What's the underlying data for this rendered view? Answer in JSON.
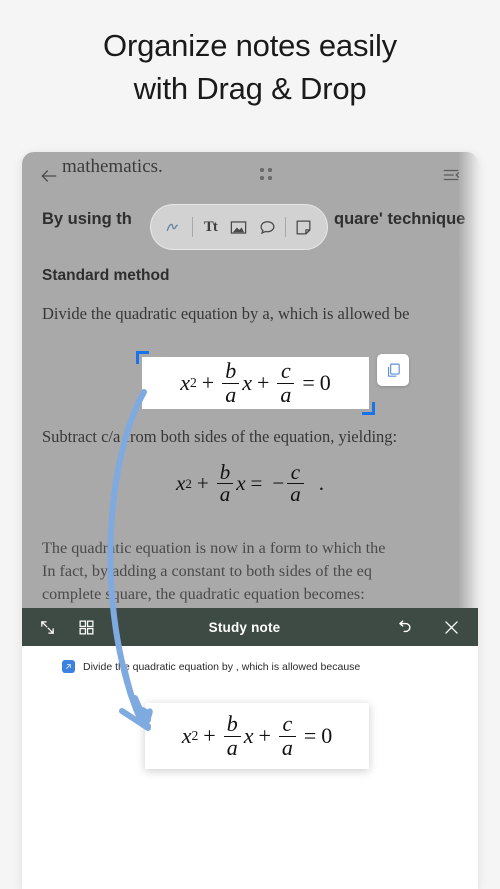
{
  "headline": {
    "line1": "Organize notes easily",
    "line2": "with Drag & Drop"
  },
  "document": {
    "scroll_title": "mathematics.",
    "back_icon": "back-arrow-icon",
    "drag_handle_icon": "drag-dots-icon",
    "menu_icon": "menu-collapse-icon",
    "intro_line": "By using th",
    "intro_line_tail": "quare' technique",
    "heading": "Standard method",
    "paragraph_1": "Divide the quadratic equation by a, which is allowed be",
    "paragraph_2": "Subtract c/a from both sides of the equation, yielding:",
    "paragraph_3_line1": "The quadratic equation is now in a form to which the",
    "paragraph_3_line2": "In fact, by adding a constant to both sides of the eq",
    "paragraph_3_line3": "complete square, the quadratic equation becomes:",
    "copy_button_icon": "copy-icon"
  },
  "toolbar": {
    "pen_icon": "pen-scribble-icon",
    "text_label": "Tt",
    "image_icon": "image-icon",
    "comment_icon": "speech-bubble-icon",
    "note_icon": "sticky-note-icon"
  },
  "note_bar": {
    "expand_icon": "expand-arrows-icon",
    "grid_icon": "grid-squares-icon",
    "title": "Study note",
    "undo_icon": "undo-icon",
    "close_icon": "close-icon"
  },
  "note_body": {
    "badge_icon": "link-badge-icon",
    "item_text": "Divide the quadratic equation by , which is allowed because"
  },
  "formula": {
    "x": "x",
    "exp": "2",
    "plus": "+",
    "equals": "=",
    "minus": "−",
    "b": "b",
    "c": "c",
    "a": "a",
    "zero": "0",
    "period": "."
  },
  "colors": {
    "accent_blue": "#1a73e8",
    "arrow_blue": "#7eaae0",
    "note_bar_bg": "#3e4a44",
    "doc_dim": "#a9a9a9",
    "badge_blue": "#3b82e0"
  }
}
